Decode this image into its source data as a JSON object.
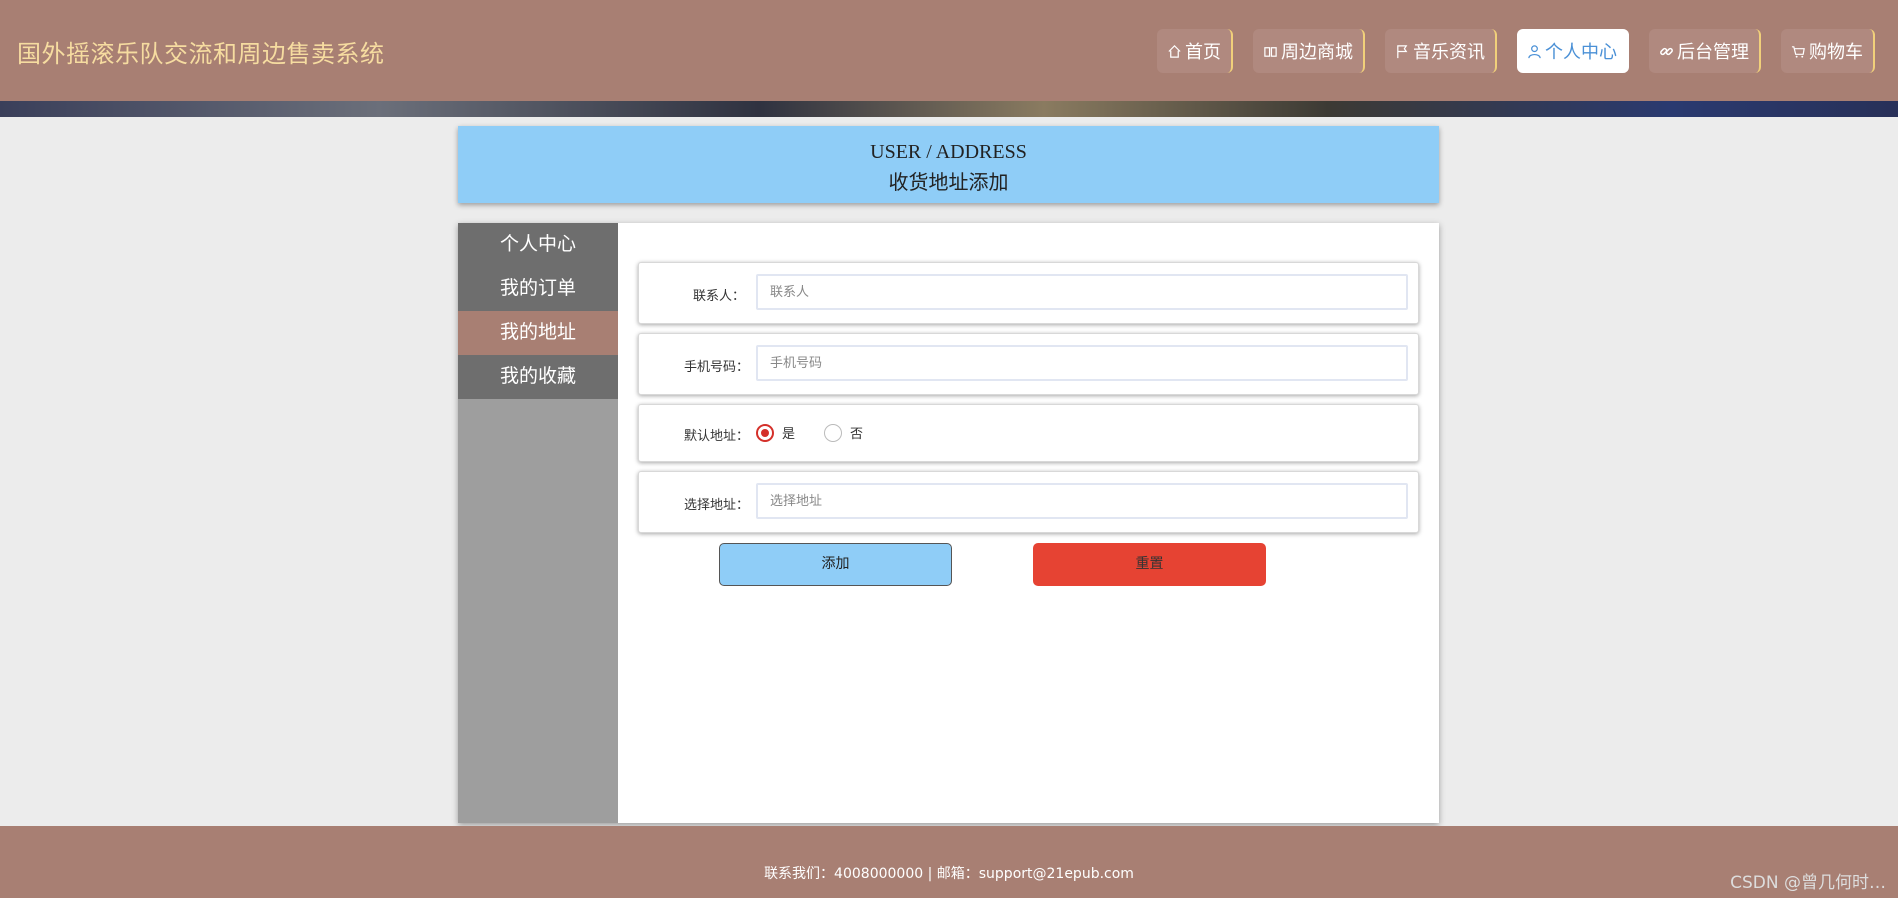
{
  "site": {
    "title": "国外摇滚乐队交流和周边售卖系统"
  },
  "nav": [
    {
      "icon": "home-icon",
      "label": "首页"
    },
    {
      "icon": "store-icon",
      "label": "周边商城"
    },
    {
      "icon": "flag-icon",
      "label": "音乐资讯"
    },
    {
      "icon": "user-icon",
      "label": "个人中心",
      "active": true
    },
    {
      "icon": "link-icon",
      "label": "后台管理"
    },
    {
      "icon": "cart-icon",
      "label": "购物车"
    }
  ],
  "page_title": {
    "en": "USER / ADDRESS",
    "cn": "收货地址添加"
  },
  "sidebar": {
    "items": [
      {
        "label": "个人中心"
      },
      {
        "label": "我的订单"
      },
      {
        "label": "我的地址",
        "active": true
      },
      {
        "label": "我的收藏"
      }
    ]
  },
  "form": {
    "contact": {
      "label": "联系人：",
      "value": "",
      "placeholder": "联系人"
    },
    "phone": {
      "label": "手机号码：",
      "value": "",
      "placeholder": "手机号码"
    },
    "default_addr": {
      "label": "默认地址：",
      "options": [
        "是",
        "否"
      ],
      "selected": "是"
    },
    "address": {
      "label": "选择地址：",
      "value": "",
      "placeholder": "选择地址"
    },
    "add_button": "添加",
    "reset_button": "重置"
  },
  "footer": {
    "text": "联系我们：4008000000 | 邮箱：support@21epub.com"
  },
  "watermark": "CSDN @曾几何时…",
  "colors": {
    "header": "#a87f73",
    "title_box": "#8fcdf7",
    "accent_text": "#f6dca0",
    "reset": "#e64333",
    "active_nav_text": "#4a90d6"
  }
}
